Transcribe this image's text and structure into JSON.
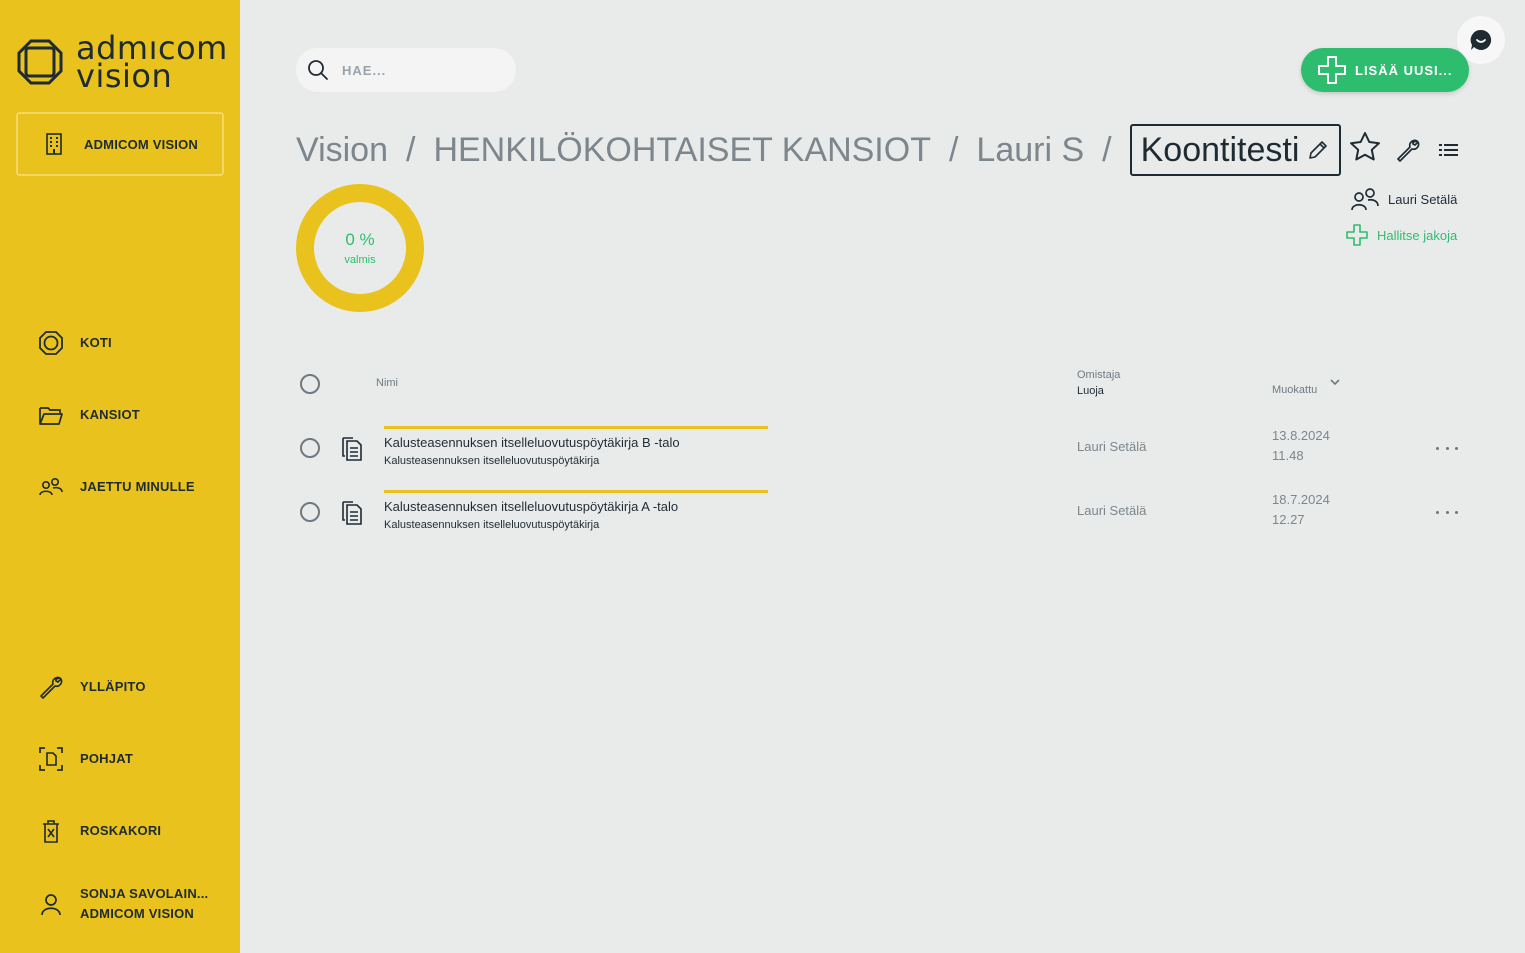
{
  "colors": {
    "sidebar": "#e9c21d",
    "accent_green": "#2ebd6e",
    "background": "#e9ebeb",
    "text_dark": "#1f2b33"
  },
  "brand": {
    "logo_line1": "admıcom",
    "logo_line2": "vision"
  },
  "sidebar": {
    "org_label": "ADMICOM VISION",
    "nav": [
      {
        "label": "KOTI",
        "icon": "home-icon"
      },
      {
        "label": "KANSIOT",
        "icon": "folder-icon"
      },
      {
        "label": "JAETTU MINULLE",
        "icon": "shared-users-icon"
      },
      {
        "label": "YLLÄPITO",
        "icon": "wrench-icon"
      },
      {
        "label": "POHJAT",
        "icon": "template-icon"
      },
      {
        "label": "ROSKAKORI",
        "icon": "trash-icon"
      }
    ],
    "user": {
      "name": "SONJA SAVOLAIN...",
      "org": "ADMICOM VISION",
      "icon": "user-icon"
    }
  },
  "search": {
    "placeholder": "HAE..."
  },
  "add_button": {
    "label": "LISÄÄ UUSI..."
  },
  "breadcrumb": {
    "items": [
      "Vision",
      "HENKILÖKOHTAISET KANSIOT",
      "Lauri S"
    ],
    "separator": "/",
    "current": "Koontitesti"
  },
  "owner": {
    "name": "Lauri Setälä"
  },
  "share": {
    "label": "Hallitse jakoja"
  },
  "progress": {
    "percent": 0,
    "percent_label": "0 %",
    "sub_label": "valmis"
  },
  "table": {
    "col_name": "Nimi",
    "col_owner": "Omistaja",
    "col_creator": "Luoja",
    "col_modified": "Muokattu",
    "rows": [
      {
        "name": "Kalusteasennuksen itselleluovutuspöytäkirja B -talo",
        "type": "Kalusteasennuksen itselleluovutuspöytäkirja",
        "owner": "Lauri Setälä",
        "date": "13.8.2024",
        "time": "11.48"
      },
      {
        "name": "Kalusteasennuksen itselleluovutuspöytäkirja A -talo",
        "type": "Kalusteasennuksen itselleluovutuspöytäkirja",
        "owner": "Lauri Setälä",
        "date": "18.7.2024",
        "time": "12.27"
      }
    ]
  }
}
